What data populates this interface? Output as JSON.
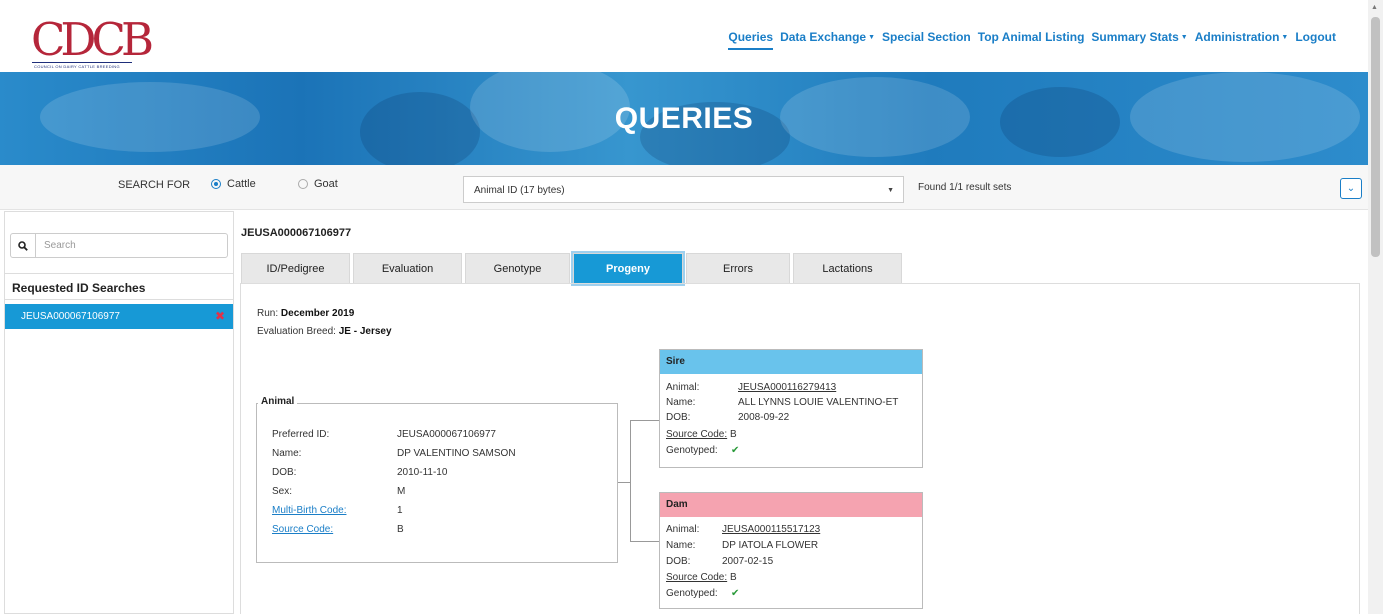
{
  "logo": {
    "text": "CDCB",
    "subtitle": "COUNCIL ON DAIRY CATTLE BREEDING"
  },
  "nav": [
    {
      "label": "Queries",
      "active": true,
      "dropdown": false
    },
    {
      "label": "Data Exchange",
      "active": false,
      "dropdown": true
    },
    {
      "label": "Special Section",
      "active": false,
      "dropdown": false
    },
    {
      "label": "Top Animal Listing",
      "active": false,
      "dropdown": false
    },
    {
      "label": "Summary Stats",
      "active": false,
      "dropdown": true
    },
    {
      "label": "Administration",
      "active": false,
      "dropdown": true
    },
    {
      "label": "Logout",
      "active": false,
      "dropdown": false
    }
  ],
  "banner": {
    "title": "QUERIES"
  },
  "search_bar": {
    "label": "SEARCH FOR",
    "options": [
      {
        "label": "Cattle",
        "selected": true
      },
      {
        "label": "Goat",
        "selected": false
      }
    ],
    "id_type": "Animal ID (17 bytes)",
    "result_text": "Found 1/1 result sets"
  },
  "sidebar": {
    "search_placeholder": "Search",
    "header": "Requested ID Searches",
    "items": [
      {
        "label": "JEUSA000067106977"
      }
    ]
  },
  "main": {
    "animal_id": "JEUSA000067106977",
    "tabs": [
      {
        "label": "ID/Pedigree",
        "active": false
      },
      {
        "label": "Evaluation",
        "active": false
      },
      {
        "label": "Genotype",
        "active": false
      },
      {
        "label": "Progeny",
        "active": true
      },
      {
        "label": "Errors",
        "active": false
      },
      {
        "label": "Lactations",
        "active": false
      }
    ],
    "run_label": "Run:",
    "run_value": "December 2019",
    "breed_label": "Evaluation Breed:",
    "breed_value": "JE - Jersey"
  },
  "animal": {
    "legend": "Animal",
    "rows": [
      {
        "label": "Preferred ID:",
        "value": "JEUSA000067106977",
        "link": false
      },
      {
        "label": "Name:",
        "value": "DP VALENTINO SAMSON",
        "link": false
      },
      {
        "label": "DOB:",
        "value": "2010-11-10",
        "link": false
      },
      {
        "label": "Sex:",
        "value": "M",
        "link": false
      },
      {
        "label": "Multi-Birth Code:",
        "value": "1",
        "link": true
      },
      {
        "label": "Source Code:",
        "value": "B",
        "link": true
      }
    ]
  },
  "sire": {
    "title": "Sire",
    "animal_label": "Animal:",
    "animal_value": "JEUSA000116279413",
    "name_label": "Name:",
    "name_value": "ALL LYNNS LOUIE VALENTINO-ET",
    "dob_label": "DOB:",
    "dob_value": "2008-09-22",
    "source_label": "Source Code:",
    "source_value": "B",
    "genotyped_label": "Genotyped:",
    "genotyped_value": "✔"
  },
  "dam": {
    "title": "Dam",
    "animal_label": "Animal:",
    "animal_value": "JEUSA000115517123",
    "name_label": "Name:",
    "name_value": "DP IATOLA FLOWER",
    "dob_label": "DOB:",
    "dob_value": "2007-02-15",
    "source_label": "Source Code:",
    "source_value": "B",
    "genotyped_label": "Genotyped:",
    "genotyped_value": "✔"
  },
  "icons": {
    "search": "search-icon",
    "remove": "close-icon",
    "collapse": "chevron-down-icon",
    "dropdown": "caret-down-icon",
    "check": "check-icon"
  },
  "colors": {
    "accent": "#1799d6",
    "link": "#1a7ec7",
    "sire_header": "#69c3ec",
    "dam_header": "#f5a3b0",
    "remove": "#e0324a",
    "check": "#2a9a3a",
    "logo": "#b5263a"
  }
}
